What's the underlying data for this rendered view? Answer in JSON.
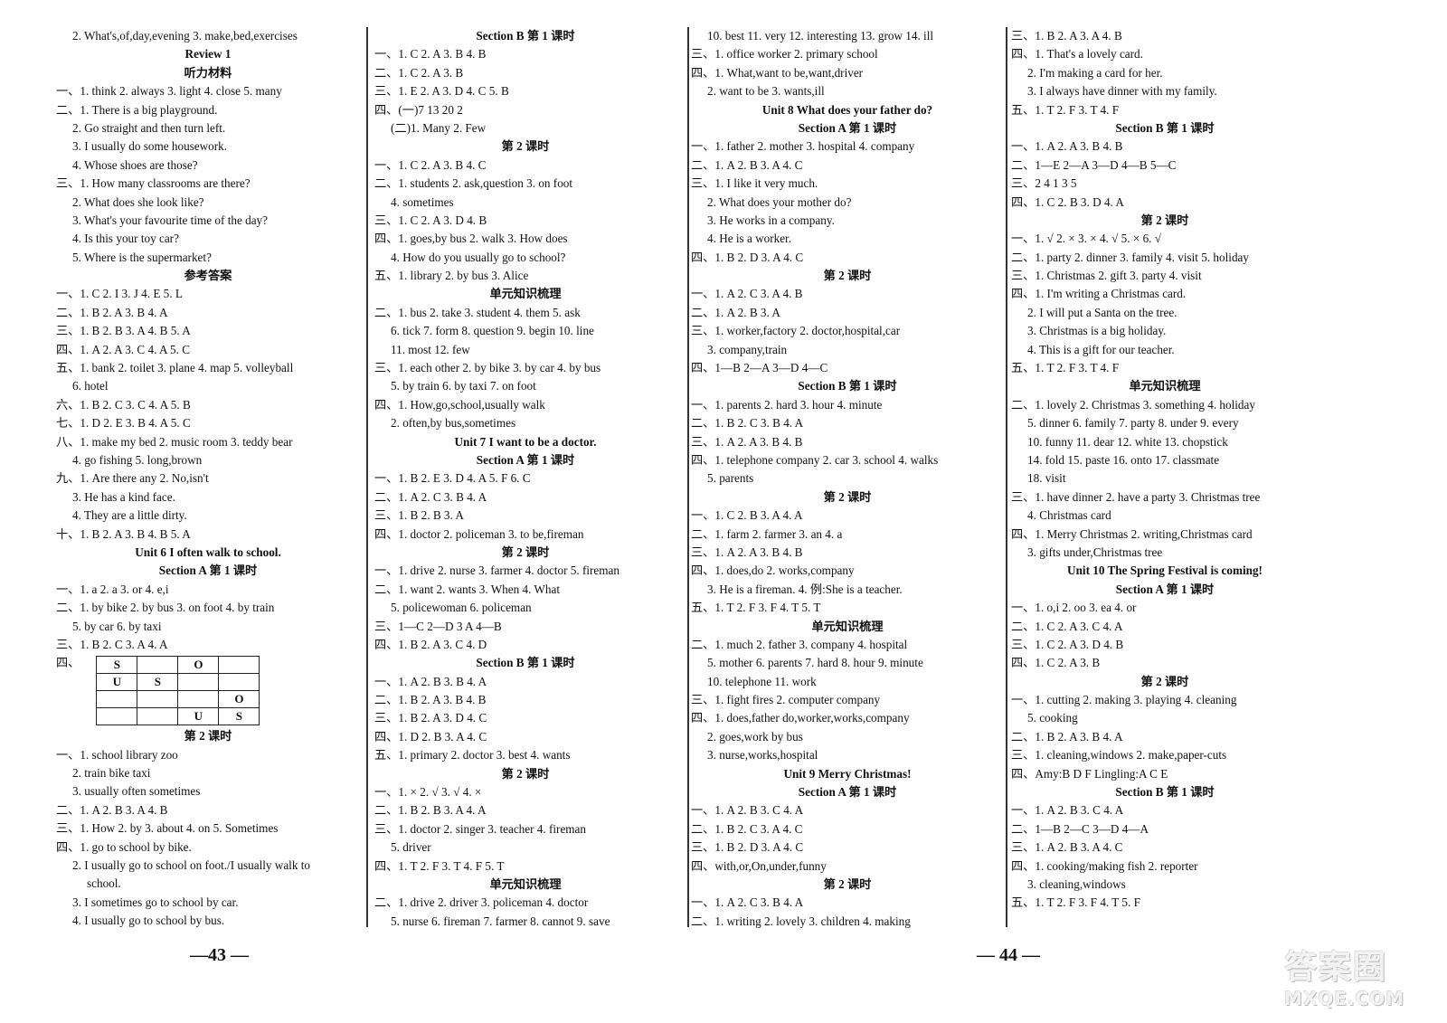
{
  "columns": [
    [
      {
        "t": "2. What's,of,day,evening   3. make,bed,exercises",
        "s": "ind"
      },
      {
        "t": "Review 1",
        "s": "head"
      },
      {
        "t": "听力材料",
        "s": "head"
      },
      {
        "t": "一、1. think   2. always   3. light   4. close   5. many"
      },
      {
        "t": "二、1. There is a big playground."
      },
      {
        "t": "2. Go straight and then turn left.",
        "s": "ind"
      },
      {
        "t": "3. I usually do some housework.",
        "s": "ind"
      },
      {
        "t": "4. Whose shoes are those?",
        "s": "ind"
      },
      {
        "t": "三、1. How many classrooms are there?"
      },
      {
        "t": "2. What does she look like?",
        "s": "ind"
      },
      {
        "t": "3. What's your favourite time of the day?",
        "s": "ind"
      },
      {
        "t": "4. Is this your toy car?",
        "s": "ind"
      },
      {
        "t": "5. Where is the supermarket?",
        "s": "ind"
      },
      {
        "t": "参考答案",
        "s": "head"
      },
      {
        "t": "一、1. C   2. I   3. J   4. E   5. L"
      },
      {
        "t": "二、1. B   2. A   3. B   4. A"
      },
      {
        "t": "三、1. B   2. B   3. A   4. B   5. A"
      },
      {
        "t": "四、1. A   2. A   3. C   4. A   5. C"
      },
      {
        "t": "五、1. bank   2. toilet   3. plane   4. map   5. volleyball"
      },
      {
        "t": "6. hotel",
        "s": "ind"
      },
      {
        "t": "六、1. B   2. C   3. C   4. A   5. B"
      },
      {
        "t": "七、1. D   2. E   3. B   4. A   5. C"
      },
      {
        "t": "八、1. make my bed   2. music room   3. teddy bear"
      },
      {
        "t": "4. go fishing   5. long,brown",
        "s": "ind"
      },
      {
        "t": "九、1. Are there any   2. No,isn't"
      },
      {
        "t": "3. He has a kind face.",
        "s": "ind"
      },
      {
        "t": "4. They are a little dirty.",
        "s": "ind"
      },
      {
        "t": "十、1. B   2. A   3. B   4. B   5. A"
      },
      {
        "t": "Unit 6   I often walk to school.",
        "s": "head"
      },
      {
        "t": "Section A   第 1 课时",
        "s": "head"
      },
      {
        "t": "一、1. a   2. a   3. or   4. e,i"
      },
      {
        "t": "二、1. by bike   2. by bus   3. on foot   4. by train"
      },
      {
        "t": "5. by car   6. by taxi",
        "s": "ind"
      },
      {
        "t": "三、1. B   2. C   3. A   4. A"
      },
      {
        "grid_label": "四、",
        "grid": [
          [
            "S",
            "",
            "O",
            ""
          ],
          [
            "U",
            "S",
            "",
            ""
          ],
          [
            "",
            "",
            "",
            "O"
          ],
          [
            "",
            "",
            "U",
            "S"
          ]
        ]
      },
      {
        "t": "第 2 课时",
        "s": "head"
      },
      {
        "t": "一、1. school   library   zoo"
      },
      {
        "t": "2. train   bike   taxi",
        "s": "ind"
      },
      {
        "t": "3. usually   often   sometimes",
        "s": "ind"
      },
      {
        "t": "二、1. A   2. B   3. A   4. B"
      },
      {
        "t": "三、1. How   2. by   3. about   4. on   5. Sometimes"
      },
      {
        "t": "四、1. go to school by bike."
      },
      {
        "t": "2. I usually go to school on foot./I usually walk to",
        "s": "ind"
      },
      {
        "t": "school.",
        "s": "ind2"
      },
      {
        "t": "3. I sometimes go to school by car.",
        "s": "ind"
      },
      {
        "t": "4. I usually go to school by bus.",
        "s": "ind"
      }
    ],
    [
      {
        "t": "Section B   第 1 课时",
        "s": "head"
      },
      {
        "t": "一、1. C   2. A   3. B   4. B"
      },
      {
        "t": "二、1. C   2. A   3. B"
      },
      {
        "t": "三、1. E   2. A   3. D   4. C   5. B"
      },
      {
        "t": "四、(一)7   13   20   2"
      },
      {
        "t": "(二)1. Many   2. Few",
        "s": "ind"
      },
      {
        "t": "第 2 课时",
        "s": "head"
      },
      {
        "t": "一、1. C   2. A   3. B   4. C"
      },
      {
        "t": "二、1. students   2. ask,question   3. on foot"
      },
      {
        "t": "4. sometimes",
        "s": "ind"
      },
      {
        "t": "三、1. C   2. A   3. D   4. B"
      },
      {
        "t": "四、1. goes,by bus   2. walk   3. How does"
      },
      {
        "t": "4. How do you usually go to school?",
        "s": "ind"
      },
      {
        "t": "五、1. library   2. by bus   3. Alice"
      },
      {
        "t": "单元知识梳理",
        "s": "head"
      },
      {
        "t": "二、1. bus   2. take   3. student   4. them   5. ask"
      },
      {
        "t": "6. tick   7. form   8. question   9. begin   10. line",
        "s": "ind"
      },
      {
        "t": "11. most   12. few",
        "s": "ind"
      },
      {
        "t": "三、1. each other   2. by bike   3. by car   4. by bus"
      },
      {
        "t": "5. by train   6. by taxi   7. on foot",
        "s": "ind"
      },
      {
        "t": "四、1. How,go,school,usually walk"
      },
      {
        "t": "2. often,by bus,sometimes",
        "s": "ind"
      },
      {
        "t": "Unit 7   I want to be a doctor.",
        "s": "head"
      },
      {
        "t": "Section A   第 1 课时",
        "s": "head"
      },
      {
        "t": "一、1. B   2. E   3. D   4. A   5. F   6. C"
      },
      {
        "t": "二、1. A   2. C   3. B   4. A"
      },
      {
        "t": "三、1. B   2. B   3. A"
      },
      {
        "t": "四、1. doctor   2. policeman   3. to be,fireman"
      },
      {
        "t": "第 2 课时",
        "s": "head"
      },
      {
        "t": "一、1. drive   2. nurse   3. farmer   4. doctor   5. fireman"
      },
      {
        "t": "二、1. want   2. wants   3. When   4. What"
      },
      {
        "t": "5. policewoman   6. policeman",
        "s": "ind"
      },
      {
        "t": "三、1—C   2—D   3   A   4—B"
      },
      {
        "t": "四、1. B   2. A   3. C   4. D"
      },
      {
        "t": "Section B   第 1 课时",
        "s": "head"
      },
      {
        "t": "一、1. A   2. B   3. B   4. A"
      },
      {
        "t": "二、1. B   2. A   3. B   4. B"
      },
      {
        "t": "三、1. B   2. A   3. D   4. C"
      },
      {
        "t": "四、1. D   2. B   3. A   4. C"
      },
      {
        "t": "五、1. primary   2. doctor   3. best   4. wants"
      },
      {
        "t": "第 2 课时",
        "s": "head"
      },
      {
        "t": "一、1. ×   2. √   3. √   4. ×"
      },
      {
        "t": "二、1. B   2. B   3. A   4. A"
      },
      {
        "t": "三、1. doctor   2. singer   3. teacher   4. fireman"
      },
      {
        "t": "5. driver",
        "s": "ind"
      },
      {
        "t": "四、1. T   2. F   3. T   4. F   5. T"
      },
      {
        "t": "单元知识梳理",
        "s": "head"
      },
      {
        "t": "二、1. drive   2. driver   3. policeman   4. doctor"
      },
      {
        "t": "5. nurse   6. fireman   7. farmer   8. cannot   9. save",
        "s": "ind"
      }
    ],
    [
      {
        "t": "10. best   11. very   12. interesting   13. grow   14. ill",
        "s": "ind"
      },
      {
        "t": "三、1. office worker   2. primary school"
      },
      {
        "t": "四、1. What,want to be,want,driver"
      },
      {
        "t": "2. want to be   3. wants,ill",
        "s": "ind"
      },
      {
        "t": "Unit 8   What does your father do?",
        "s": "head"
      },
      {
        "t": "Section A   第 1 课时",
        "s": "head"
      },
      {
        "t": "一、1. father   2. mother   3. hospital   4. company"
      },
      {
        "t": "二、1. A   2. B   3. A   4. C"
      },
      {
        "t": "三、1. I like it very much."
      },
      {
        "t": "2. What does your mother do?",
        "s": "ind"
      },
      {
        "t": "3. He works in a company.",
        "s": "ind"
      },
      {
        "t": "4. He is a worker.",
        "s": "ind"
      },
      {
        "t": "四、1. B   2. D   3. A   4. C"
      },
      {
        "t": "第 2 课时",
        "s": "head"
      },
      {
        "t": "一、1. A   2. C   3. A   4. B"
      },
      {
        "t": "二、1. A   2. B   3. A"
      },
      {
        "t": "三、1. worker,factory   2. doctor,hospital,car"
      },
      {
        "t": "3. company,train",
        "s": "ind"
      },
      {
        "t": "四、1—B   2—A   3—D   4—C"
      },
      {
        "t": "Section B   第 1 课时",
        "s": "head"
      },
      {
        "t": "一、1. parents   2. hard   3. hour   4. minute"
      },
      {
        "t": "二、1. B   2. C   3. B   4. A"
      },
      {
        "t": "三、1. A   2. A   3. B   4. B"
      },
      {
        "t": "四、1. telephone company   2. car   3. school   4. walks"
      },
      {
        "t": "5. parents",
        "s": "ind"
      },
      {
        "t": "第 2 课时",
        "s": "head"
      },
      {
        "t": "一、1. C   2. B   3. A   4. A"
      },
      {
        "t": "二、1. farm   2. farmer   3. an   4. a"
      },
      {
        "t": "三、1. A   2. A   3. B   4. B"
      },
      {
        "t": "四、1. does,do   2. works,company"
      },
      {
        "t": "3. He is a fireman.   4. 例:She is a teacher.",
        "s": "ind"
      },
      {
        "t": "五、1. T   2. F   3. F   4. T   5. T"
      },
      {
        "t": "单元知识梳理",
        "s": "head"
      },
      {
        "t": "二、1. much   2. father   3. company   4. hospital"
      },
      {
        "t": "5. mother   6. parents   7. hard   8. hour   9. minute",
        "s": "ind"
      },
      {
        "t": "10. telephone   11. work",
        "s": "ind"
      },
      {
        "t": "三、1. fight fires   2. computer company"
      },
      {
        "t": "四、1. does,father do,worker,works,company"
      },
      {
        "t": "2. goes,work by bus",
        "s": "ind"
      },
      {
        "t": "3. nurse,works,hospital",
        "s": "ind"
      },
      {
        "t": "Unit 9   Merry Christmas!",
        "s": "head"
      },
      {
        "t": "Section A   第 1 课时",
        "s": "head"
      },
      {
        "t": "一、1. A   2. B   3. C   4. A"
      },
      {
        "t": "二、1. B   2. C   3. A   4. C"
      },
      {
        "t": "三、1. B   2. D   3. A   4. C"
      },
      {
        "t": "四、with,or,On,under,funny"
      },
      {
        "t": "第 2 课时",
        "s": "head"
      },
      {
        "t": "一、1. A   2. C   3. B   4. A"
      },
      {
        "t": "二、1. writing   2. lovely   3. children   4. making"
      }
    ],
    [
      {
        "t": "三、1. B   2. A   3. A   4. B"
      },
      {
        "t": "四、1. That's a lovely card."
      },
      {
        "t": "2. I'm making a card for her.",
        "s": "ind"
      },
      {
        "t": "3. I always have dinner with my family.",
        "s": "ind"
      },
      {
        "t": "五、1. T   2. F   3. T   4. F"
      },
      {
        "t": "Section B   第 1 课时",
        "s": "head"
      },
      {
        "t": "一、1. A   2. A   3. B   4. B"
      },
      {
        "t": "二、1—E   2—A   3—D   4—B   5—C"
      },
      {
        "t": "三、2   4   1   3   5"
      },
      {
        "t": "四、1. C   2. B   3. D   4. A"
      },
      {
        "t": "第 2 课时",
        "s": "head"
      },
      {
        "t": "一、1. √   2. ×   3. ×   4. √   5. ×   6. √"
      },
      {
        "t": "二、1. party   2. dinner   3. family   4. visit   5. holiday"
      },
      {
        "t": "三、1. Christmas   2. gift   3. party   4. visit"
      },
      {
        "t": "四、1. I'm writing a Christmas card."
      },
      {
        "t": "2. I will put a Santa on the tree.",
        "s": "ind"
      },
      {
        "t": "3. Christmas is a big holiday.",
        "s": "ind"
      },
      {
        "t": "4. This is a gift for our teacher.",
        "s": "ind"
      },
      {
        "t": "五、1. T   2. F   3. T   4. F"
      },
      {
        "t": "单元知识梳理",
        "s": "head"
      },
      {
        "t": "二、1. lovely   2. Christmas   3. something   4. holiday"
      },
      {
        "t": "5. dinner   6. family   7. party   8. under   9. every",
        "s": "ind"
      },
      {
        "t": "10. funny   11. dear   12. white   13. chopstick",
        "s": "ind"
      },
      {
        "t": "14. fold   15. paste   16. onto   17. classmate",
        "s": "ind"
      },
      {
        "t": "18. visit",
        "s": "ind"
      },
      {
        "t": "三、1. have dinner   2. have a party   3. Christmas tree"
      },
      {
        "t": "4. Christmas card",
        "s": "ind"
      },
      {
        "t": "四、1. Merry Christmas   2. writing,Christmas card"
      },
      {
        "t": "3. gifts under,Christmas tree",
        "s": "ind"
      },
      {
        "t": "Unit 10   The Spring Festival is coming!",
        "s": "head"
      },
      {
        "t": "Section A   第 1 课时",
        "s": "head"
      },
      {
        "t": "一、1. o,i   2. oo   3. ea   4. or"
      },
      {
        "t": "二、1. C   2. A   3. C   4. A"
      },
      {
        "t": "三、1. C   2. A   3. D   4. B"
      },
      {
        "t": "四、1. C   2. A   3. B"
      },
      {
        "t": "第 2 课时",
        "s": "head"
      },
      {
        "t": "一、1. cutting   2. making   3. playing   4. cleaning"
      },
      {
        "t": "5. cooking",
        "s": "ind"
      },
      {
        "t": "二、1. B   2. A   3. B   4. A"
      },
      {
        "t": "三、1. cleaning,windows   2. make,paper-cuts"
      },
      {
        "t": "四、Amy:B D F   Lingling:A C E"
      },
      {
        "t": "Section B   第 1 课时",
        "s": "head"
      },
      {
        "t": "一、1. A   2. B   3. C   4. A"
      },
      {
        "t": "二、1—B   2—C   3—D   4—A"
      },
      {
        "t": "三、1. A   2. B   3. A   4. C"
      },
      {
        "t": "四、1. cooking/making fish   2. reporter"
      },
      {
        "t": "3. cleaning,windows",
        "s": "ind"
      },
      {
        "t": "五、1. T   2. F   3. F   4. T   5. F"
      }
    ]
  ],
  "page_numbers": {
    "left": "—43 —",
    "right": "— 44 —"
  },
  "watermark": {
    "line1": "答案圈",
    "line2": "MXQE.COM"
  }
}
